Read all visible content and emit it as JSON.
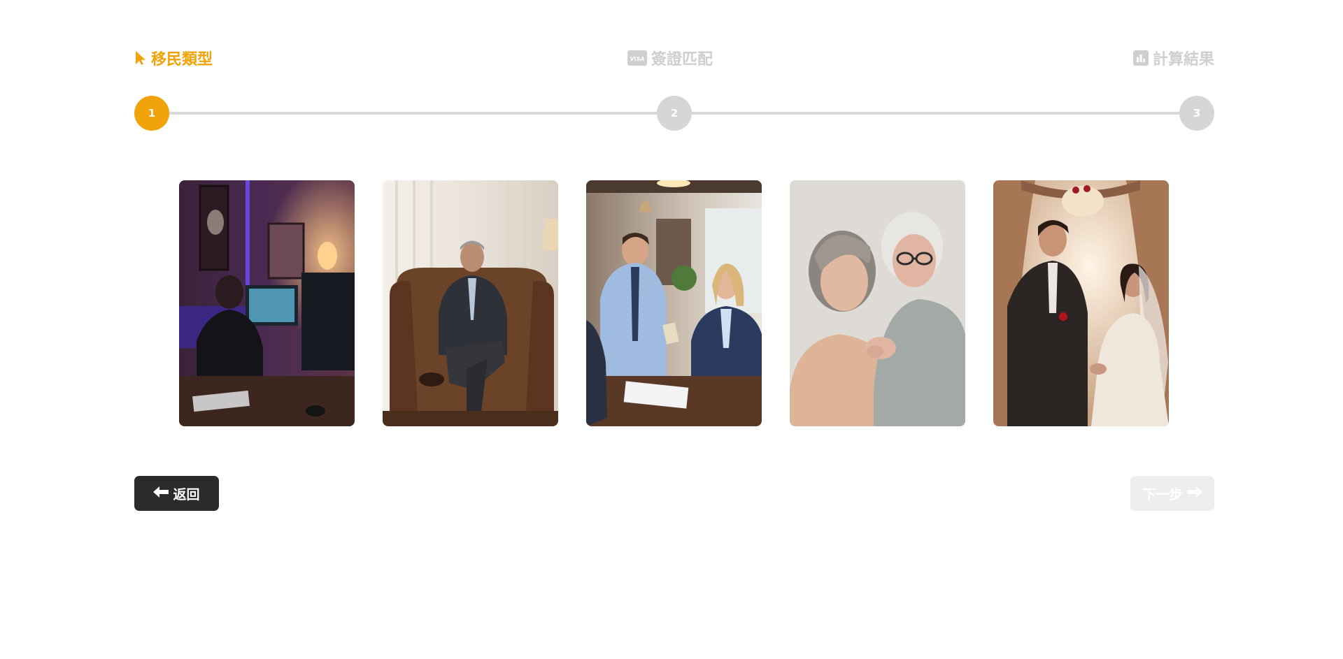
{
  "steps": [
    {
      "label": "移民類型",
      "number": "1",
      "icon": "pointer-icon",
      "active": true
    },
    {
      "label": "簽證匹配",
      "number": "2",
      "icon": "visa-card-icon",
      "active": false
    },
    {
      "label": "計算結果",
      "number": "3",
      "icon": "bar-chart-icon",
      "active": false
    }
  ],
  "visa_icon_text": "VISA",
  "cards": [
    {
      "id": "skilled-worker",
      "depicts": "person coding at desk in purple-lit room"
    },
    {
      "id": "investor",
      "depicts": "man in suit seated in leather armchair"
    },
    {
      "id": "business",
      "depicts": "two professionals exchanging money at desk"
    },
    {
      "id": "parents",
      "depicts": "two elderly women embracing"
    },
    {
      "id": "spouse",
      "depicts": "bride and groom at wedding"
    }
  ],
  "buttons": {
    "back_label": "返回",
    "next_label": "下一步"
  },
  "colors": {
    "accent": "#f0a30a",
    "inactive": "#d6d6d6",
    "back_button": "#2b2b2b",
    "next_button_disabled": "#eeeeee"
  }
}
